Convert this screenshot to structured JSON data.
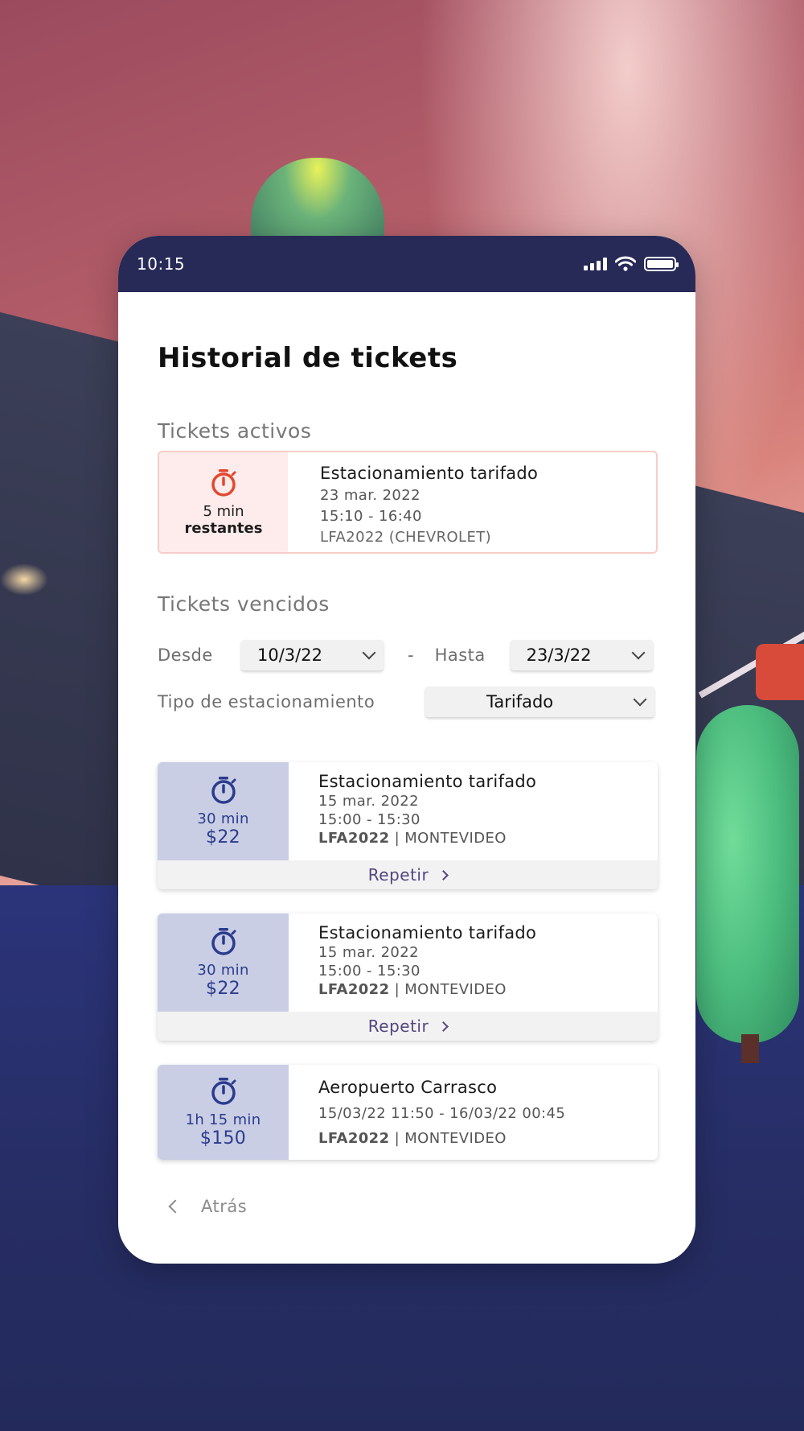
{
  "status_bar": {
    "time": "10:15"
  },
  "page": {
    "title": "Historial de tickets"
  },
  "active_section": {
    "label": "Tickets activos",
    "ticket": {
      "remaining_value": "5 min",
      "remaining_label": "restantes",
      "title": "Estacionamiento tarifado",
      "date": "23 mar. 2022",
      "time": "15:10 - 16:40",
      "vehicle": "LFA2022 (CHEVROLET)",
      "icon": "timer-icon",
      "accent_color": "#e2472f"
    }
  },
  "expired_section": {
    "label": "Tickets vencidos",
    "filters": {
      "from_label": "Desde",
      "from_value": "10/3/22",
      "separator": "-",
      "to_label": "Hasta",
      "to_value": "23/3/22",
      "type_label": "Tipo de estacionamiento",
      "type_value": "Tarifado"
    },
    "tickets": [
      {
        "duration": "30 min",
        "price": "$22",
        "title": "Estacionamiento tarifado",
        "date": "15 mar. 2022",
        "time": "15:00 - 15:30",
        "plate": "LFA2022",
        "city": "| MONTEVIDEO",
        "action": "Repetir"
      },
      {
        "duration": "30 min",
        "price": "$22",
        "title": "Estacionamiento tarifado",
        "date": "15 mar. 2022",
        "time": "15:00 - 15:30",
        "plate": "LFA2022",
        "city": "| MONTEVIDEO",
        "action": "Repetir"
      },
      {
        "duration": "1h 15 min",
        "price": "$150",
        "title": "Aeropuerto Carrasco",
        "period": "15/03/22 11:50  - 16/03/22 00:45",
        "plate": "LFA2022",
        "city": "| MONTEVIDEO"
      }
    ]
  },
  "footer": {
    "back_label": "Atrás"
  },
  "colors": {
    "status_bar": "#272a57",
    "history_accent": "#2b3b8e",
    "history_tile": "#c9cee4",
    "active_tile": "#fdeceb",
    "repeat_text": "#53457d"
  }
}
